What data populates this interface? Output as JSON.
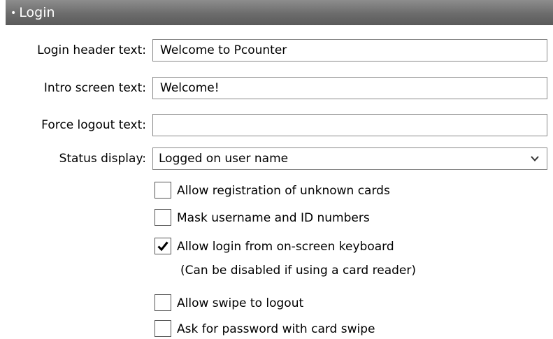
{
  "section": {
    "bullet": "•",
    "title": "Login"
  },
  "fields": {
    "login_header": {
      "label": "Login header text:",
      "value": "Welcome to Pcounter"
    },
    "intro_screen": {
      "label": "Intro screen text:",
      "value": "Welcome!"
    },
    "force_logout": {
      "label": "Force logout text:",
      "value": ""
    },
    "status_display": {
      "label": "Status display:",
      "selected": "Logged on user name"
    }
  },
  "options": {
    "allow_registration": {
      "label": "Allow registration of unknown cards",
      "checked": false
    },
    "mask_username": {
      "label": "Mask username and ID numbers",
      "checked": false
    },
    "allow_onscreen_keyboard": {
      "label": "Allow login from on-screen keyboard",
      "checked": true,
      "hint": "(Can be disabled if using a card reader)"
    },
    "allow_swipe_logout": {
      "label": "Allow swipe to logout",
      "checked": false
    },
    "ask_password_swipe": {
      "label": "Ask for password with card swipe",
      "checked": false
    }
  },
  "icons": {
    "dropdown": "chevron-down-icon",
    "checkmark": "checkmark-icon"
  }
}
